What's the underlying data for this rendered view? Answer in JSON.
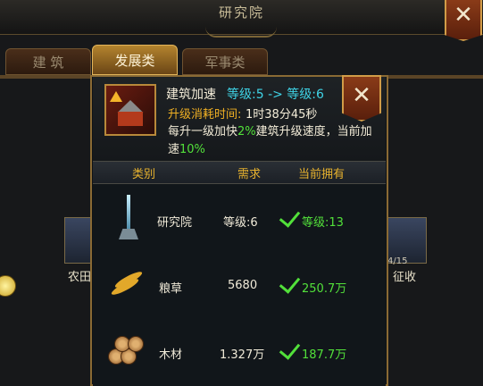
{
  "window": {
    "title": "研究院",
    "close_label": "✕"
  },
  "tabs": [
    {
      "label": "建 筑",
      "active": false
    },
    {
      "label": "发展类",
      "active": true
    },
    {
      "label": "军事类",
      "active": false
    }
  ],
  "side": {
    "left_label": "农田",
    "right_label": "征收",
    "right_sub": "4/15"
  },
  "popup": {
    "item_name": "建筑加速",
    "level_text": "等级:5 -> 等级:6",
    "time_label": "升级消耗时间:",
    "time_value": "1时38分45秒",
    "desc_a": "每升一级加快",
    "desc_pct": "2%",
    "desc_b": "建筑升级速度，当前加速",
    "desc_cur": "10%",
    "close_label": "✕",
    "columns": [
      "类别",
      "需求",
      "当前拥有"
    ],
    "rows": [
      {
        "icon": "tower-icon",
        "name": "研究院",
        "need": "等级:6",
        "have": "等级:13",
        "met": true
      },
      {
        "icon": "wheat-icon",
        "name": "粮草",
        "need": "5680",
        "have": "250.7万",
        "met": true
      },
      {
        "icon": "wood-icon",
        "name": "木材",
        "need": "1.327万",
        "have": "187.7万",
        "met": true
      }
    ]
  },
  "colors": {
    "accent": "#e7b22e",
    "ok": "#52e03a",
    "level": "#3fd3e6"
  }
}
